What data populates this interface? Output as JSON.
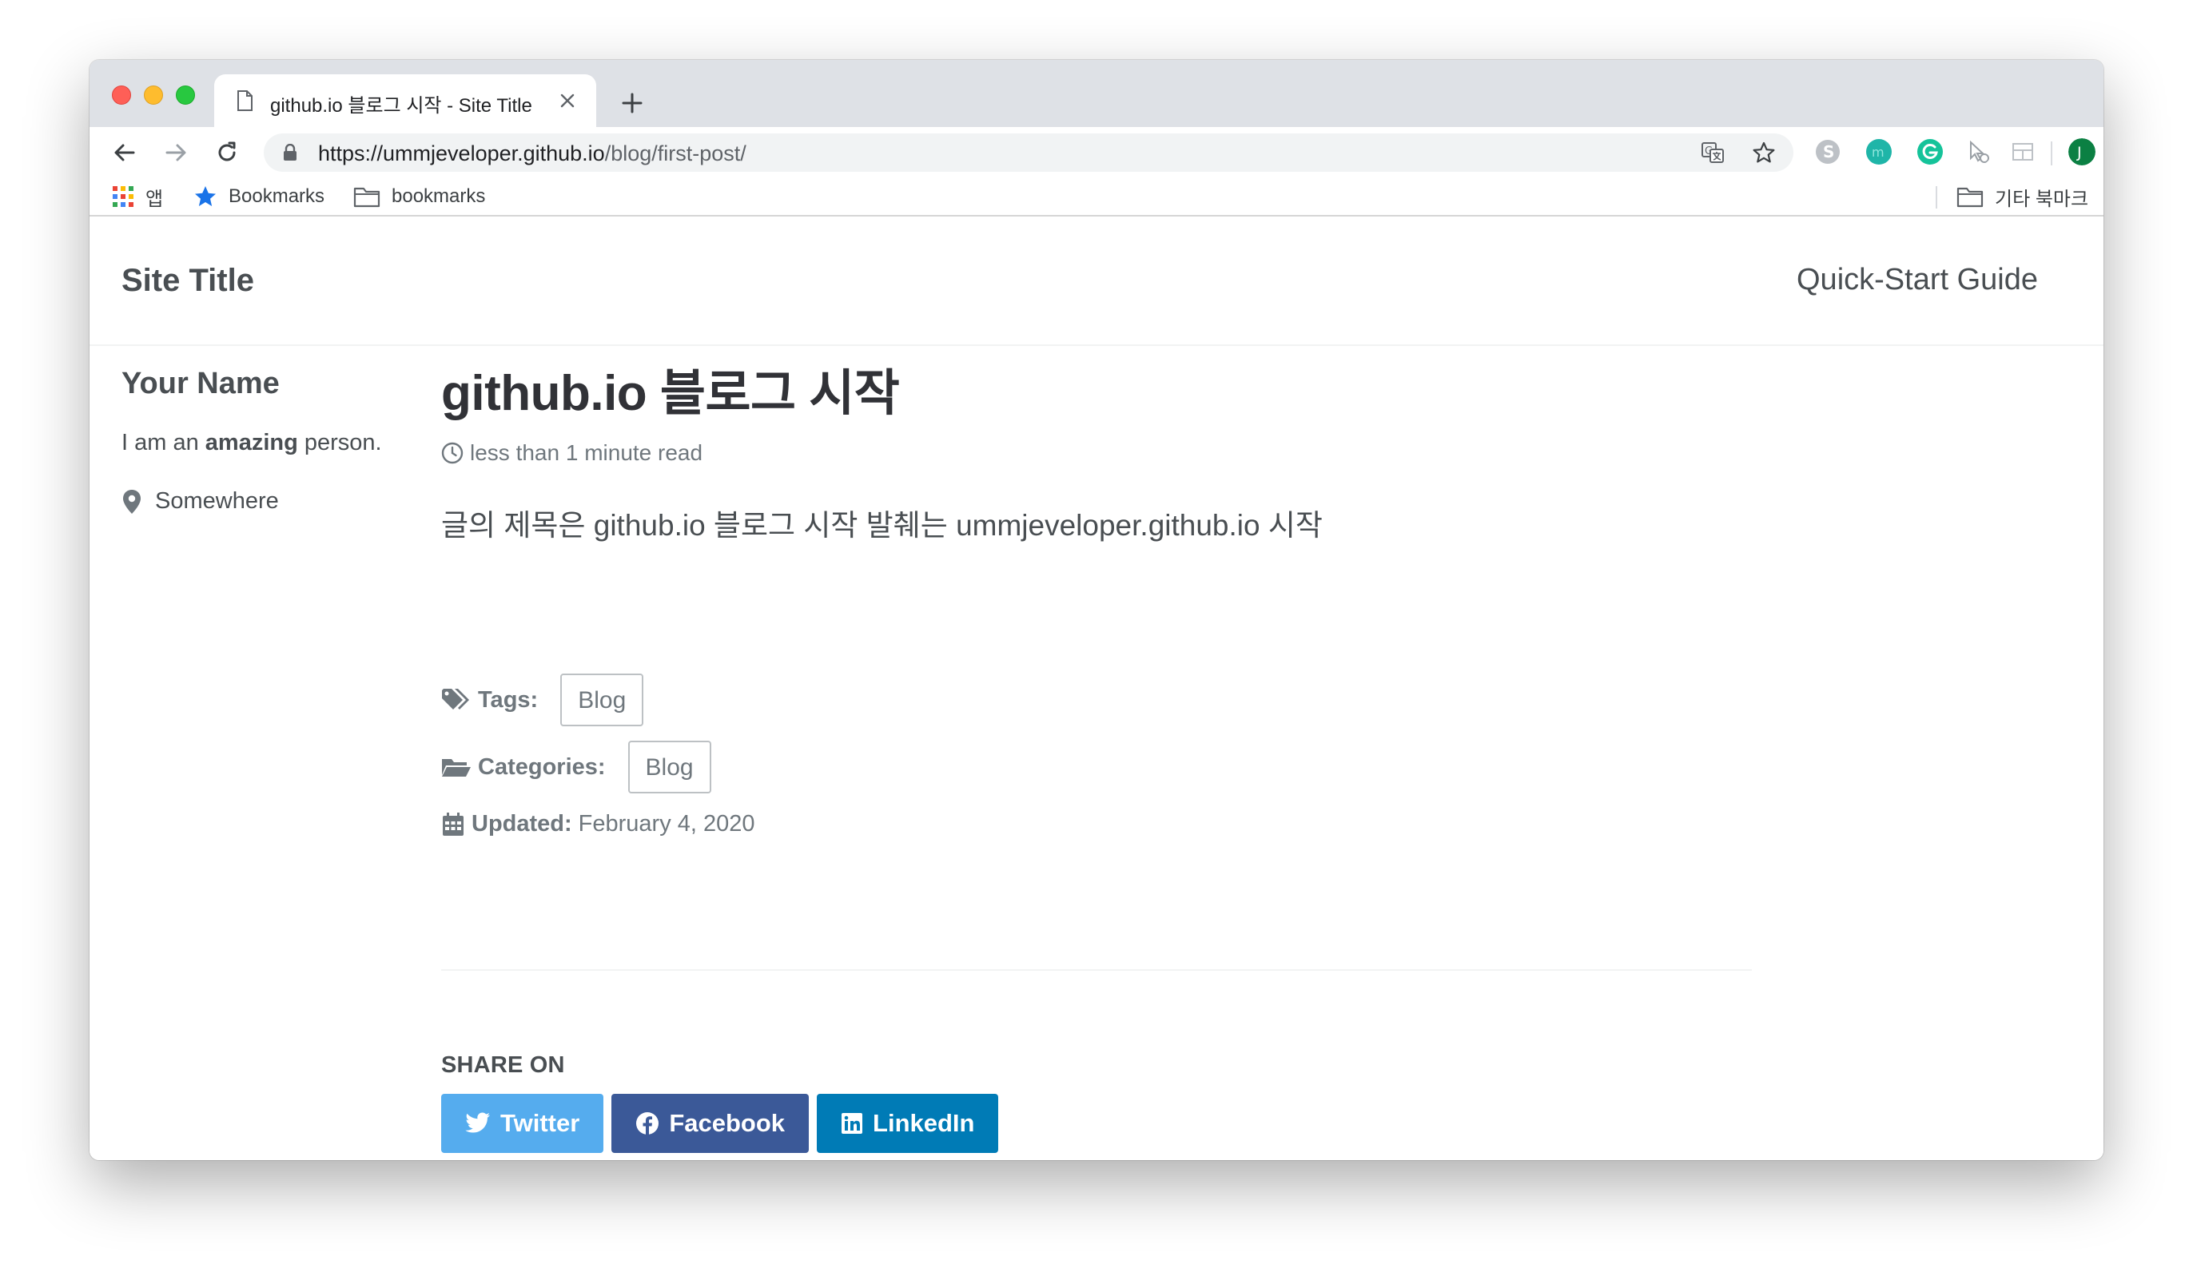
{
  "browser": {
    "tab": {
      "title": "github.io 블로그 시작 - Site Title"
    },
    "url": {
      "host": "https://ummjeveloper.github.io",
      "path": "/blog/first-post/"
    },
    "extensions": [
      {
        "name": "skype-icon",
        "color": "#bdc1c6"
      },
      {
        "name": "mendeley-icon",
        "color": "#1fb5a8"
      },
      {
        "name": "grammarly-icon",
        "color": "#15c39a"
      },
      {
        "name": "profile-avatar",
        "letter": "J",
        "color": "#0b8043"
      },
      {
        "name": "update-icon",
        "color": "#e53935"
      }
    ],
    "bookmarks": {
      "apps_label": "앱",
      "items": [
        "Bookmarks",
        "bookmarks"
      ],
      "other_label": "기타 북마크"
    }
  },
  "site": {
    "title": "Site Title",
    "nav_link": "Quick-Start Guide"
  },
  "author": {
    "name": "Your Name",
    "bio_prefix": "I am an ",
    "bio_bold": "amazing",
    "bio_suffix": " person.",
    "location": "Somewhere"
  },
  "post": {
    "title": "github.io 블로그 시작",
    "read_time": "less than 1 minute read",
    "body": "글의 제목은 github.io 블로그 시작 발췌는 ummjeveloper.github.io 시작",
    "tags_label": "Tags:",
    "tags": [
      "Blog"
    ],
    "categories_label": "Categories:",
    "categories": [
      "Blog"
    ],
    "updated_label": "Updated:",
    "updated_date": "February 4, 2020"
  },
  "share": {
    "heading": "SHARE ON",
    "buttons": [
      {
        "label": "Twitter",
        "color": "#55acee"
      },
      {
        "label": "Facebook",
        "color": "#3b5998"
      },
      {
        "label": "LinkedIn",
        "color": "#007bb6"
      }
    ]
  }
}
